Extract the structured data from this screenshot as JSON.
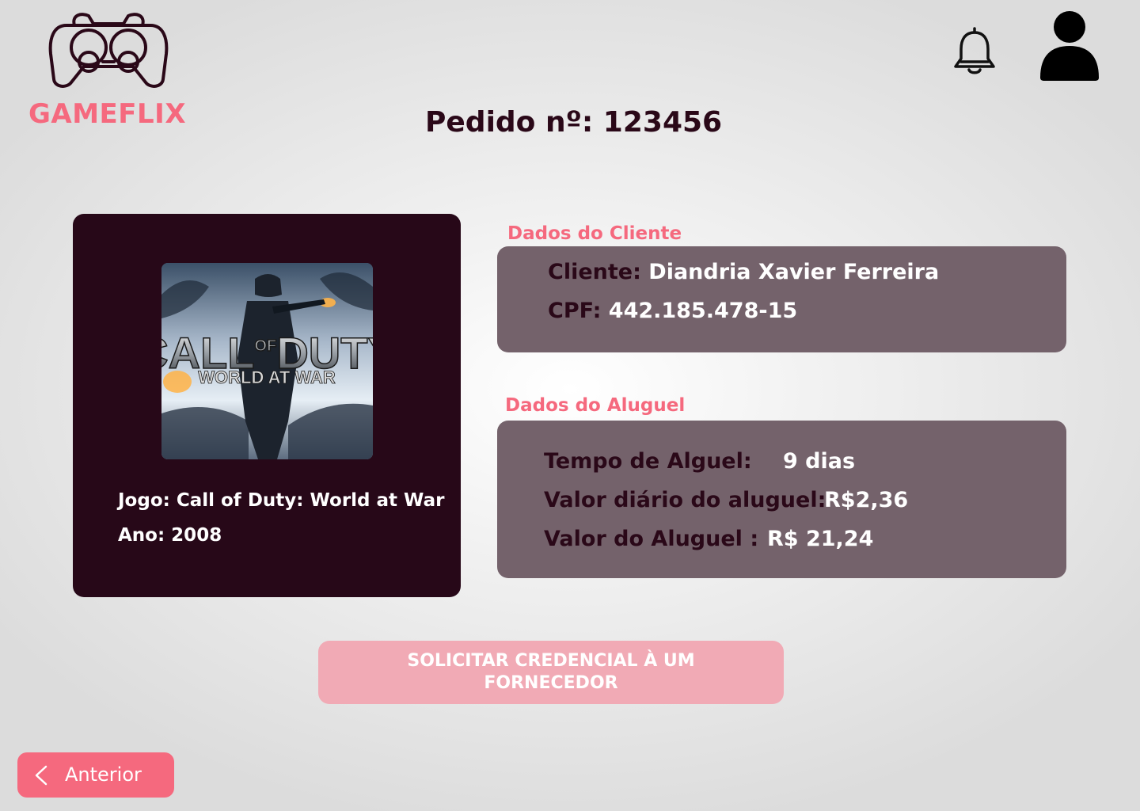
{
  "brand": {
    "name": "GAMEFLIX",
    "accent_color": "#f5697e",
    "logo_icon": "gamepad-icon"
  },
  "header": {
    "title": "Pedido nº: 123456",
    "notification_icon": "bell-icon",
    "profile_icon": "user-icon"
  },
  "game": {
    "cover_title_line1": "CALL",
    "cover_title_of": "OF",
    "cover_title_line2": "DUTY",
    "cover_subtitle": "WORLD AT WAR",
    "name_line": "Jogo: Call of Duty: World at War",
    "year_line": "Ano: 2008"
  },
  "client": {
    "section_label": "Dados do Cliente",
    "name_label": "Cliente:",
    "name_value": "Diandria Xavier Ferreira",
    "cpf_label": "CPF:",
    "cpf_value": "442.185.478-15"
  },
  "rental": {
    "section_label": "Dados do Aluguel",
    "duration_label": "Tempo de Alguel:",
    "duration_value": "9 dias",
    "daily_label": "Valor diário do aluguel:",
    "daily_value": "R$2,36",
    "total_label": "Valor do Aluguel :",
    "total_value": "R$ 21,24"
  },
  "actions": {
    "request_button": "SOLICITAR CREDENCIAL À UM FORNECEDOR",
    "back_button": "Anterior",
    "back_icon": "chevron-left-icon"
  }
}
